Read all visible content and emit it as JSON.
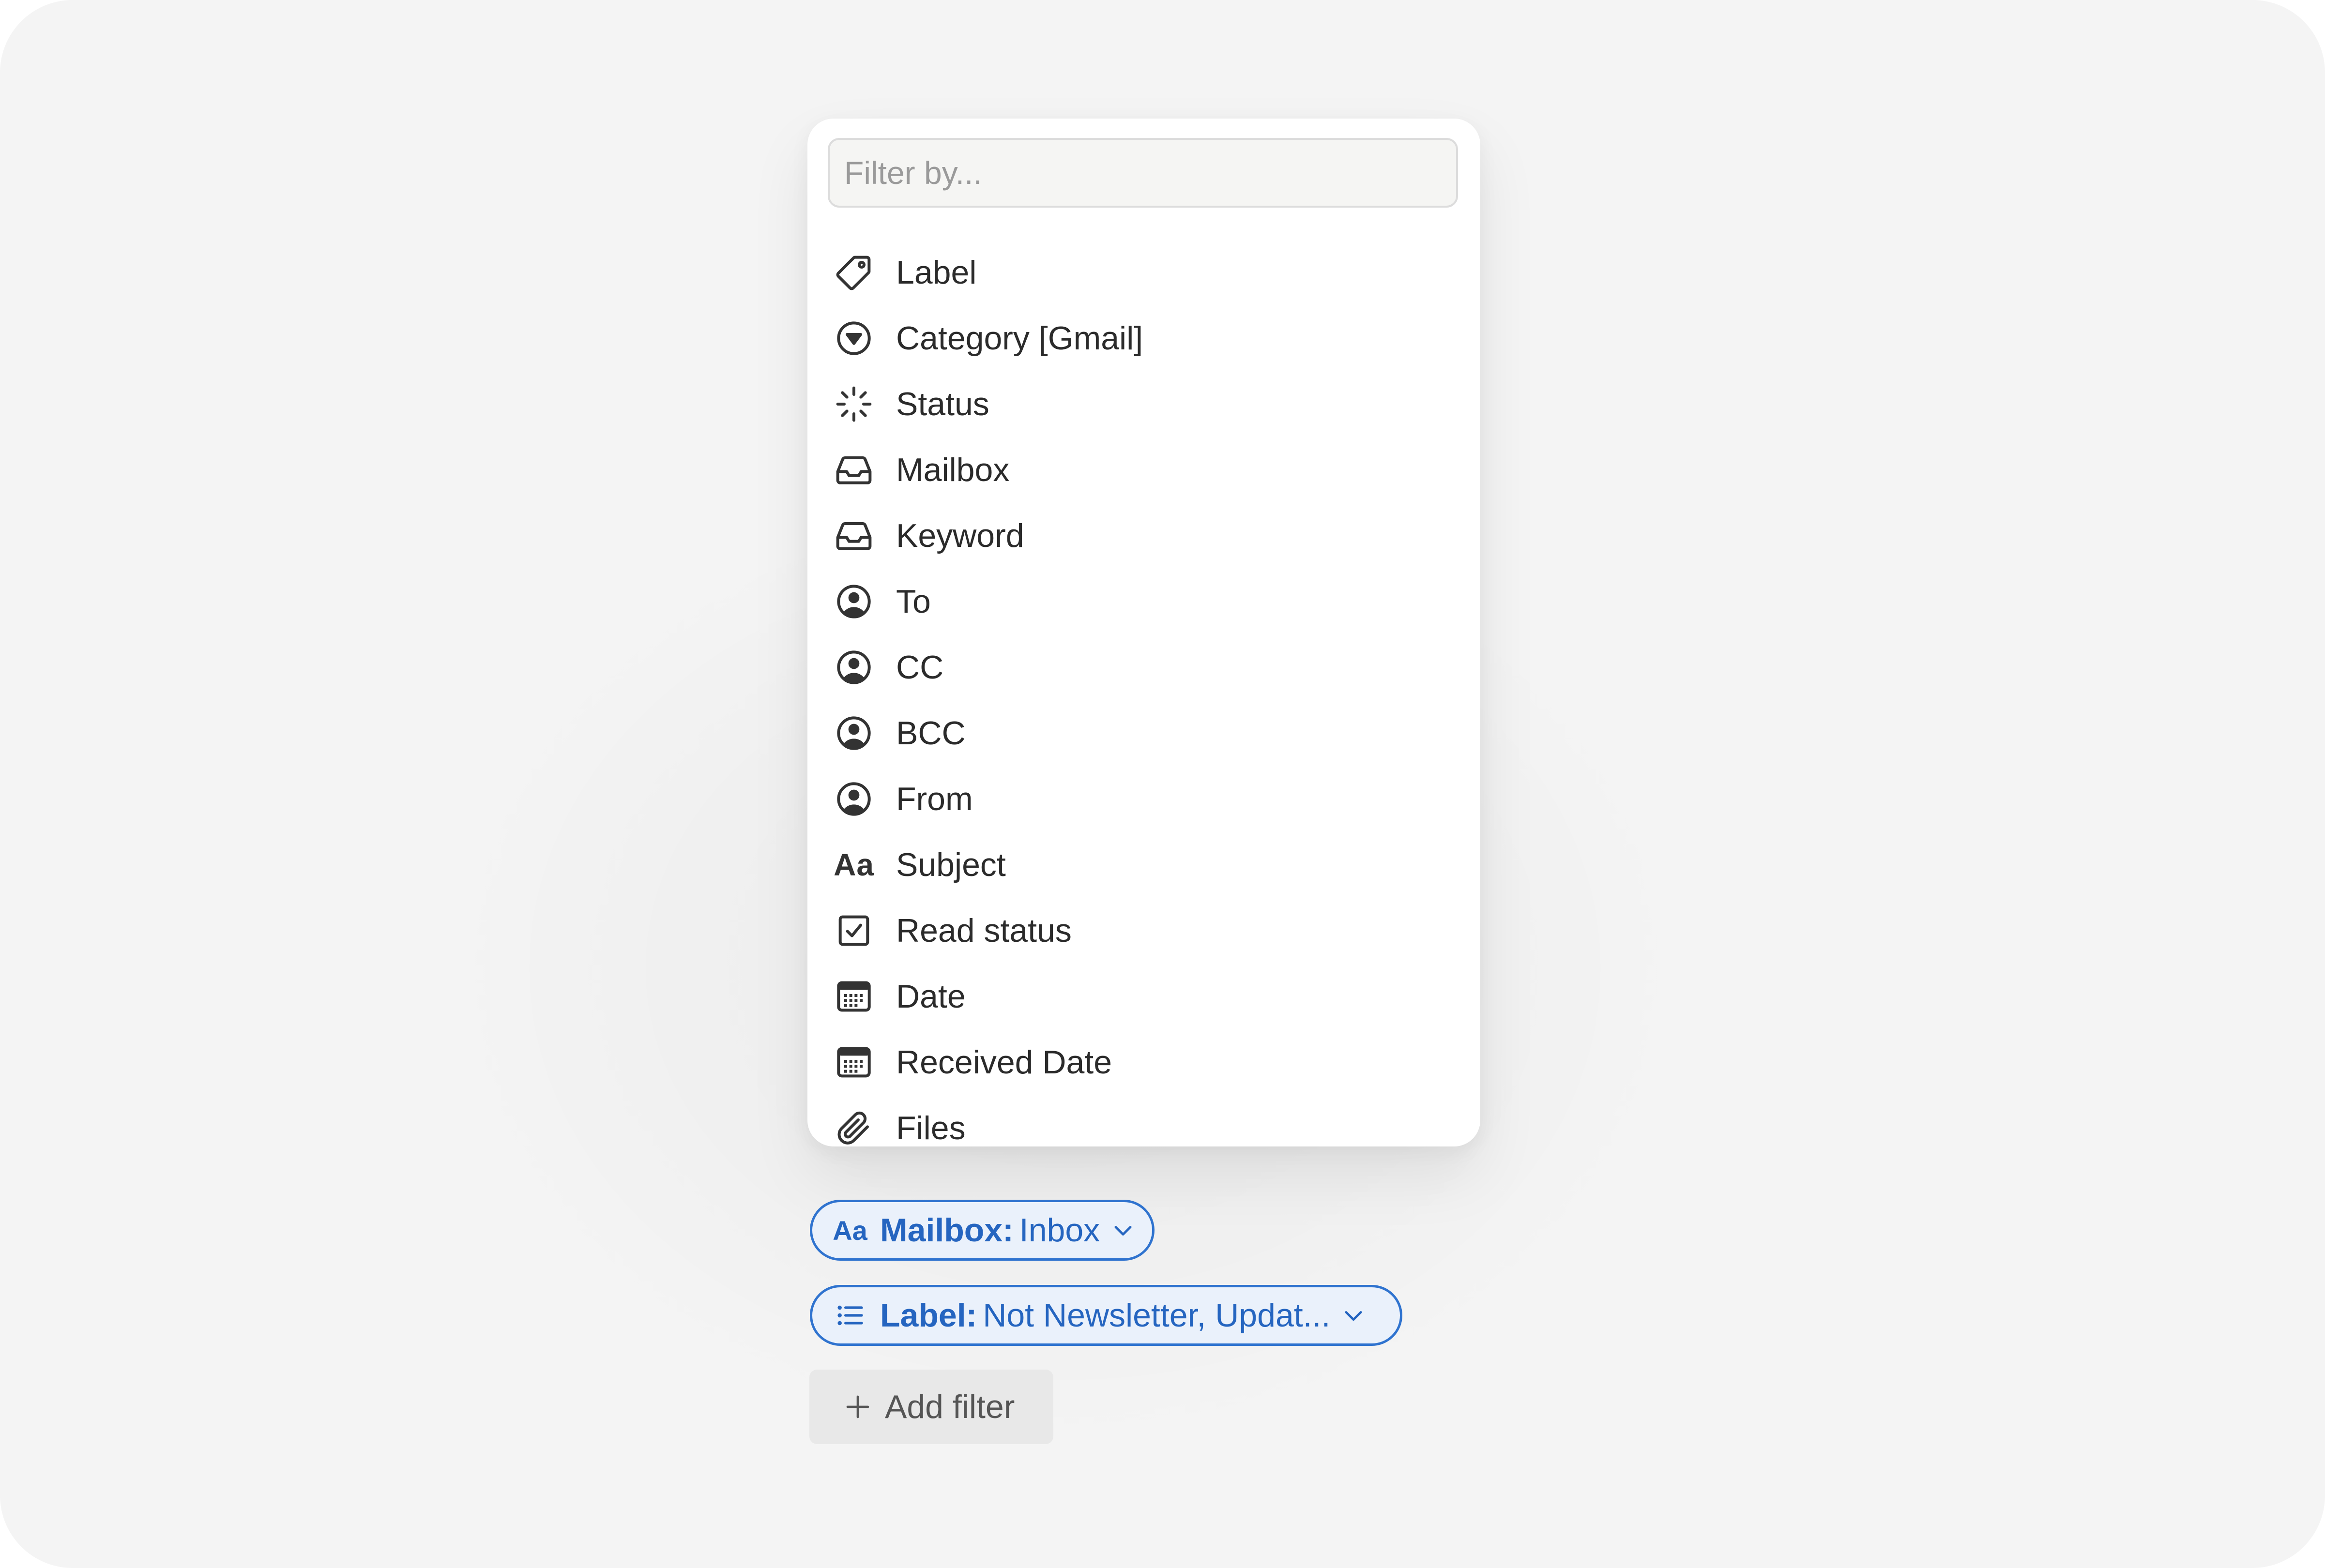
{
  "filter_menu": {
    "search_placeholder": "Filter by...",
    "items": [
      {
        "label": "Label",
        "icon": "tag-icon"
      },
      {
        "label": "Category [Gmail]",
        "icon": "category-circle-icon"
      },
      {
        "label": "Status",
        "icon": "status-spinner-icon"
      },
      {
        "label": "Mailbox",
        "icon": "inbox-tray-icon"
      },
      {
        "label": "Keyword",
        "icon": "inbox-tray-icon"
      },
      {
        "label": "To",
        "icon": "person-circle-icon"
      },
      {
        "label": "CC",
        "icon": "person-circle-icon"
      },
      {
        "label": "BCC",
        "icon": "person-circle-icon"
      },
      {
        "label": "From",
        "icon": "person-circle-icon"
      },
      {
        "label": "Subject",
        "icon": "text-aa-icon",
        "icon_text": "Aa"
      },
      {
        "label": "Read status",
        "icon": "checkbox-icon"
      },
      {
        "label": "Date",
        "icon": "calendar-icon"
      },
      {
        "label": "Received Date",
        "icon": "calendar-icon"
      },
      {
        "label": "Files",
        "icon": "paperclip-icon"
      }
    ]
  },
  "active_filters": [
    {
      "key": "Mailbox:",
      "value": "Inbox",
      "icon": "text-aa-icon",
      "icon_text": "Aa"
    },
    {
      "key": "Label:",
      "value": "Not Newsletter, Updat...",
      "icon": "list-icon"
    }
  ],
  "add_filter": {
    "label": "Add filter",
    "icon": "plus-icon"
  },
  "colors": {
    "chip_accent": "#2f73cf",
    "chip_text": "#2565c0",
    "menu_text": "#2b2b2b",
    "background": "#f4f4f4"
  }
}
